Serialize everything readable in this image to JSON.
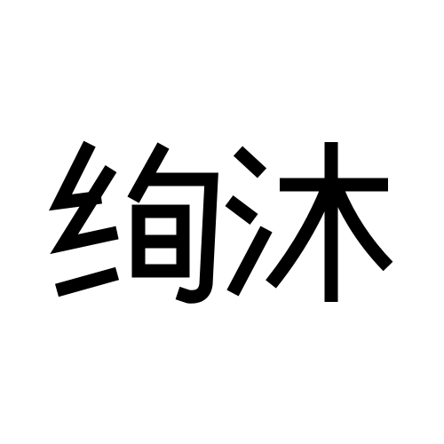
{
  "mark": {
    "text": "绚沐",
    "color": "#000000",
    "background": "#ffffff"
  }
}
